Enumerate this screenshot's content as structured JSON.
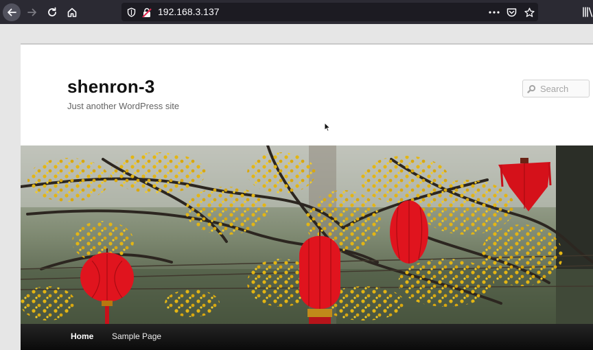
{
  "browser": {
    "url": "192.168.3.137",
    "icons": {
      "back": "arrow-left-icon",
      "forward": "arrow-right-icon",
      "reload": "reload-icon",
      "home": "home-icon",
      "tracking": "shield-icon",
      "insecure": "insecure-lock-icon",
      "more": "ellipsis-icon",
      "pocket": "pocket-icon",
      "bookmark": "star-icon",
      "library": "library-icon"
    }
  },
  "site": {
    "title": "shenron-3",
    "description": "Just another WordPress site"
  },
  "search": {
    "placeholder": "Search"
  },
  "nav": {
    "items": [
      {
        "label": "Home"
      },
      {
        "label": "Sample Page"
      }
    ]
  },
  "colors": {
    "toolbar": "#2b2a33",
    "urlbar": "#1c1b22",
    "page_bg": "#ffffff",
    "nav_bg": "#1a1a1a",
    "lantern": "#e0141e",
    "blossom": "#e3b514"
  }
}
